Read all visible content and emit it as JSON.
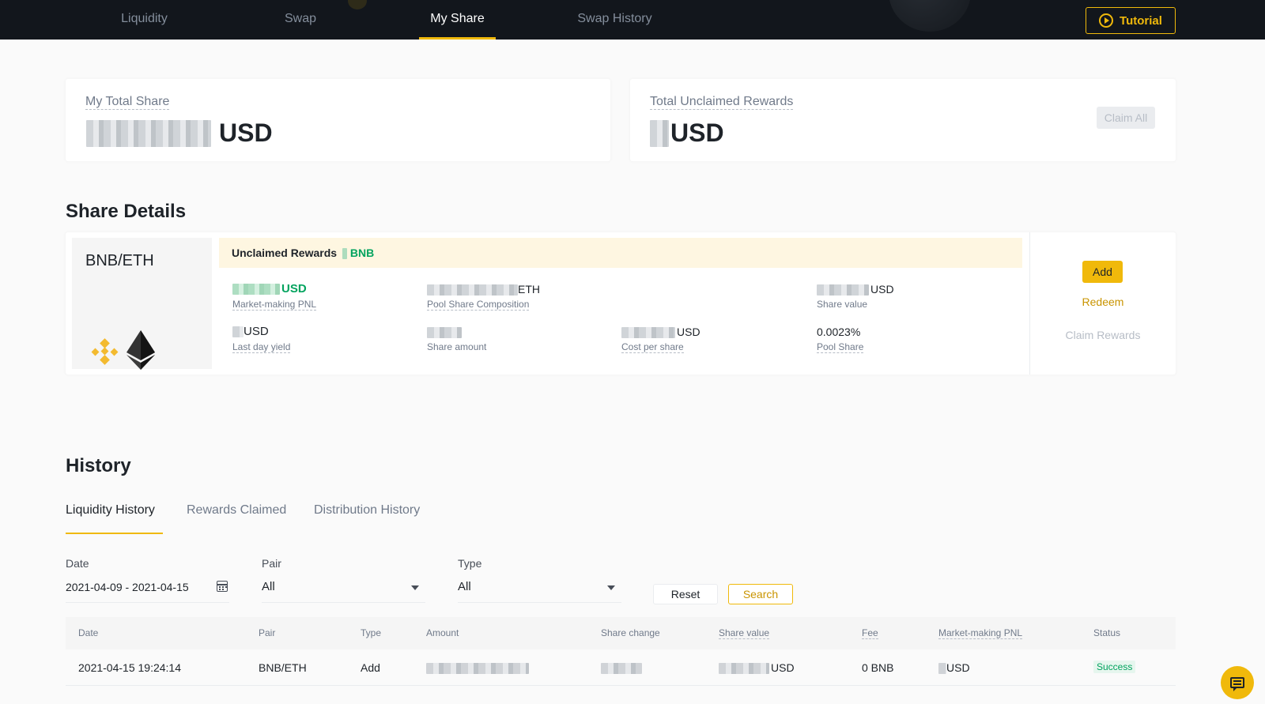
{
  "nav": {
    "tabs": [
      {
        "label": "Liquidity"
      },
      {
        "label": "Swap"
      },
      {
        "label": "My Share"
      },
      {
        "label": "Swap History"
      }
    ],
    "active_tab": "My Share",
    "tutorial_label": "Tutorial"
  },
  "summary": {
    "total_share_label": "My Total Share",
    "total_share_currency": "USD",
    "unclaimed_label": "Total Unclaimed Rewards",
    "unclaimed_currency": "USD",
    "claim_all_label": "Claim All"
  },
  "share_details": {
    "title": "Share Details",
    "pair": "BNB/ETH",
    "unclaimed_rewards_label": "Unclaimed Rewards",
    "unclaimed_rewards_currency": "BNB",
    "metrics": {
      "market_making_pnl": {
        "unit": "USD",
        "label": "Market-making PNL"
      },
      "pool_share_composition": {
        "unit": "ETH",
        "label": "Pool Share Composition"
      },
      "share_value": {
        "unit": "USD",
        "label": "Share value"
      },
      "last_day_yield": {
        "unit": "USD",
        "label": "Last day yield"
      },
      "share_amount": {
        "label": "Share amount"
      },
      "cost_per_share": {
        "unit": "USD",
        "label": "Cost per share"
      },
      "pool_share": {
        "value": "0.0023%",
        "label": "Pool Share"
      }
    },
    "actions": {
      "add": "Add",
      "redeem": "Redeem",
      "claim_rewards": "Claim Rewards"
    }
  },
  "history": {
    "title": "History",
    "tabs": [
      {
        "label": "Liquidity History"
      },
      {
        "label": "Rewards Claimed"
      },
      {
        "label": "Distribution History"
      }
    ],
    "active_tab": "Liquidity History",
    "filters": {
      "date_label": "Date",
      "date_value": "2021-04-09 - 2021-04-15",
      "pair_label": "Pair",
      "pair_value": "All",
      "type_label": "Type",
      "type_value": "All",
      "reset_label": "Reset",
      "search_label": "Search"
    },
    "table": {
      "columns": [
        "Date",
        "Pair",
        "Type",
        "Amount",
        "Share change",
        "Share value",
        "Fee",
        "Market-making PNL",
        "Status"
      ],
      "rows": [
        {
          "date": "2021-04-15 19:24:14",
          "pair": "BNB/ETH",
          "type": "Add",
          "share_value_unit": "USD",
          "fee": "0 BNB",
          "pnl_unit": "USD",
          "status": "Success"
        }
      ]
    }
  },
  "colors": {
    "accent": "#f0b90b",
    "positive": "#02a35e",
    "nav_bg": "#12161c"
  }
}
